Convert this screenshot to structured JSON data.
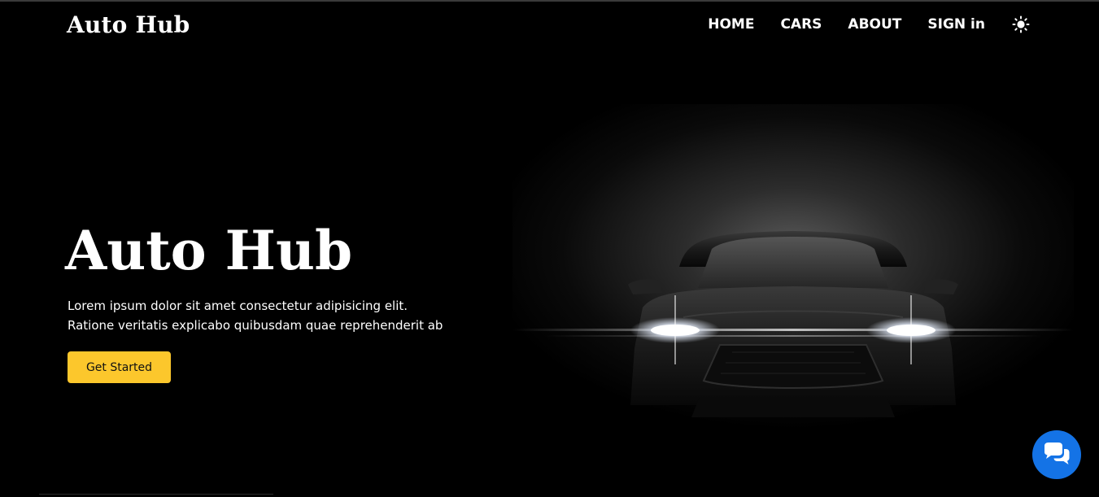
{
  "header": {
    "brand": "Auto Hub",
    "nav": {
      "home": "HOME",
      "cars": "CARS",
      "about": "ABOUT",
      "sign_in": "SIGN in"
    },
    "theme_icon": "sun-icon"
  },
  "hero": {
    "title": "Auto Hub",
    "description": "Lorem ipsum dolor sit amet consectetur adipisicing elit. Ratione veritatis explicabo quibusdam quae reprehenderit ab",
    "cta_label": "Get Started",
    "image_subject": "car-front-headlights-image"
  },
  "chat": {
    "icon": "chat-bubbles-icon"
  },
  "colors": {
    "background": "#000000",
    "accent": "#fcc72c",
    "chat_button": "#1473e6",
    "text": "#ffffff"
  }
}
